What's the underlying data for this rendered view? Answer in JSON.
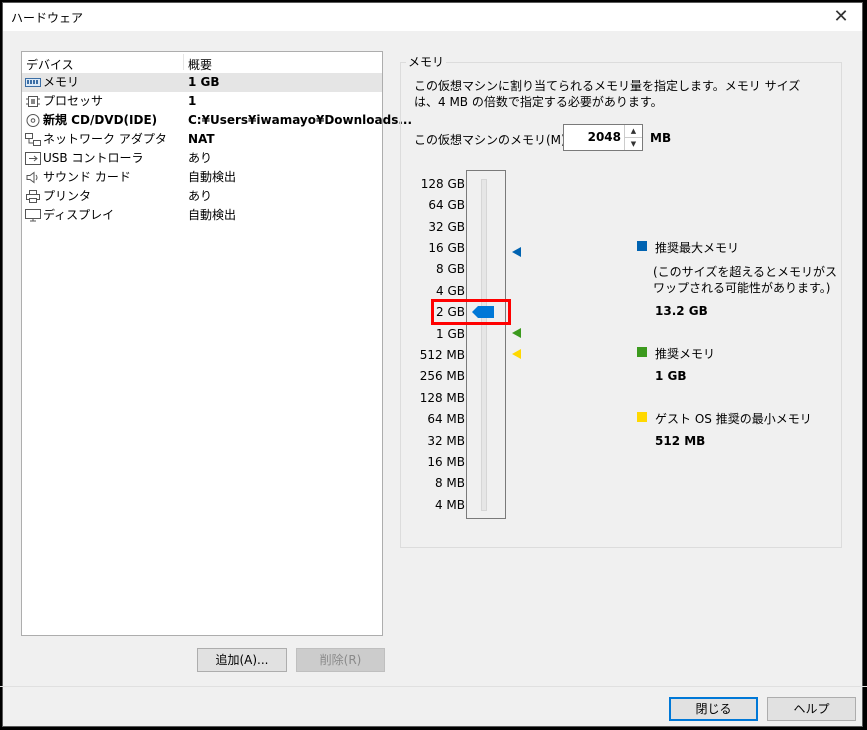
{
  "window": {
    "title": "ハードウェア",
    "close_glyph": "✕"
  },
  "devices": {
    "headers": {
      "device": "デバイス",
      "summary": "概要"
    },
    "items": [
      {
        "icon": "memory-icon",
        "name": "メモリ",
        "value": "1 GB",
        "bold": true,
        "selected": true
      },
      {
        "icon": "processor-icon",
        "name": "プロセッサ",
        "value": "1",
        "bold": true
      },
      {
        "icon": "cd-dvd-icon",
        "name": "新規 CD/DVD(IDE)",
        "value": "C:¥Users¥iwamayo¥Downloads...",
        "bold": true
      },
      {
        "icon": "network-adapter-icon",
        "name": "ネットワーク アダプタ",
        "value": "NAT",
        "bold": true
      },
      {
        "icon": "usb-controller-icon",
        "name": "USB コントローラ",
        "value": "あり"
      },
      {
        "icon": "sound-card-icon",
        "name": "サウンド カード",
        "value": "自動検出"
      },
      {
        "icon": "printer-icon",
        "name": "プリンタ",
        "value": "あり"
      },
      {
        "icon": "display-icon",
        "name": "ディスプレイ",
        "value": "自動検出"
      }
    ],
    "add_label": "追加(A)...",
    "remove_label": "削除(R)"
  },
  "memory": {
    "group_label": "メモリ",
    "description": "この仮想マシンに割り当てられるメモリ量を指定します。メモリ サイズは、4 MB の倍数で指定する必要があります。",
    "field_label": "この仮想マシンのメモリ(M):",
    "value": "2048",
    "unit": "MB",
    "scale": [
      "128 GB",
      "64 GB",
      "32 GB",
      "16 GB",
      "8 GB",
      "4 GB",
      "2 GB",
      "1 GB",
      "512 MB",
      "256 MB",
      "128 MB",
      "64 MB",
      "32 MB",
      "16 MB",
      "8 MB",
      "4 MB"
    ],
    "recommended_max": {
      "title": "推奨最大メモリ",
      "note": "(このサイズを超えるとメモリがスワップされる可能性があります。)",
      "value": "13.2 GB",
      "color": "#0063b1"
    },
    "recommended": {
      "title": "推奨メモリ",
      "value": "1 GB",
      "color": "#3c9a1e"
    },
    "guest_min": {
      "title": "ゲスト OS 推奨の最小メモリ",
      "value": "512 MB",
      "color": "#ffd800"
    },
    "highlight_color": "#ff0000"
  },
  "footer": {
    "close_label": "閉じる",
    "help_label": "ヘルプ"
  }
}
